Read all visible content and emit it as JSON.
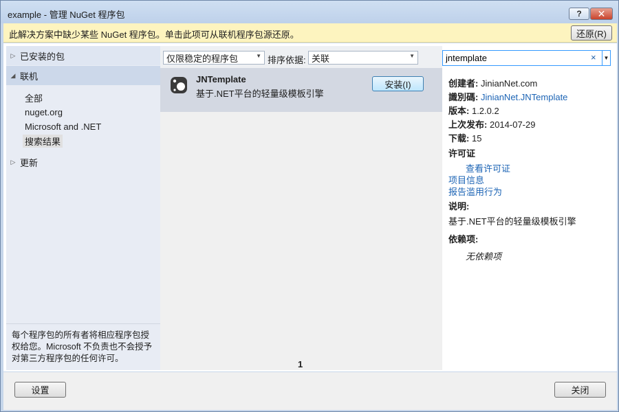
{
  "window": {
    "title": "example - 管理 NuGet 程序包",
    "help_glyph": "?",
    "close_glyph": "✕"
  },
  "infobar": {
    "message": "此解决方案中缺少某些 NuGet 程序包。单击此项可从联机程序包源还原。",
    "restore_label": "还原(R)"
  },
  "sidebar": {
    "installed_label": "已安装的包",
    "online_label": "联机",
    "online_items": [
      "全部",
      "nuget.org",
      "Microsoft and .NET",
      "搜索结果"
    ],
    "updates_label": "更新",
    "license_note": "每个程序包的所有者将相应程序包授权给您。Microsoft 不负责也不会授予对第三方程序包的任何许可。"
  },
  "filters": {
    "stability_value": "仅限稳定的程序包",
    "sort_label": "排序依据:",
    "sort_value": "关联"
  },
  "package": {
    "name": "JNTemplate",
    "description": "基于.NET平台的轻量级模板引擎",
    "install_label": "安装(I)"
  },
  "pagination": {
    "current_page": "1"
  },
  "search": {
    "value": "jntemplate",
    "clear_glyph": "×"
  },
  "details": {
    "creator_label": "创建者:",
    "creator_value": "JinianNet.com",
    "id_label": "識別碼:",
    "id_value": "JinianNet.JNTemplate",
    "version_label": "版本:",
    "version_value": "1.2.0.2",
    "published_label": "上次发布:",
    "published_value": "2014-07-29",
    "downloads_label": "下载:",
    "downloads_value": "15",
    "license_label": "许可证",
    "view_license": "查看许可证",
    "project_info": "项目信息",
    "report_abuse": "报告滥用行为",
    "description_label": "说明:",
    "description_value": "基于.NET平台的轻量级模板引擎",
    "dependencies_label": "依赖项:",
    "no_dependencies": "无依赖项"
  },
  "bottom": {
    "settings_label": "设置",
    "close_label": "关闭"
  },
  "colors": {
    "infobar_bg": "#fdf4bf",
    "link": "#1c64b5",
    "selected_row": "#d3d8e2",
    "install_border": "#3c7fb1"
  }
}
